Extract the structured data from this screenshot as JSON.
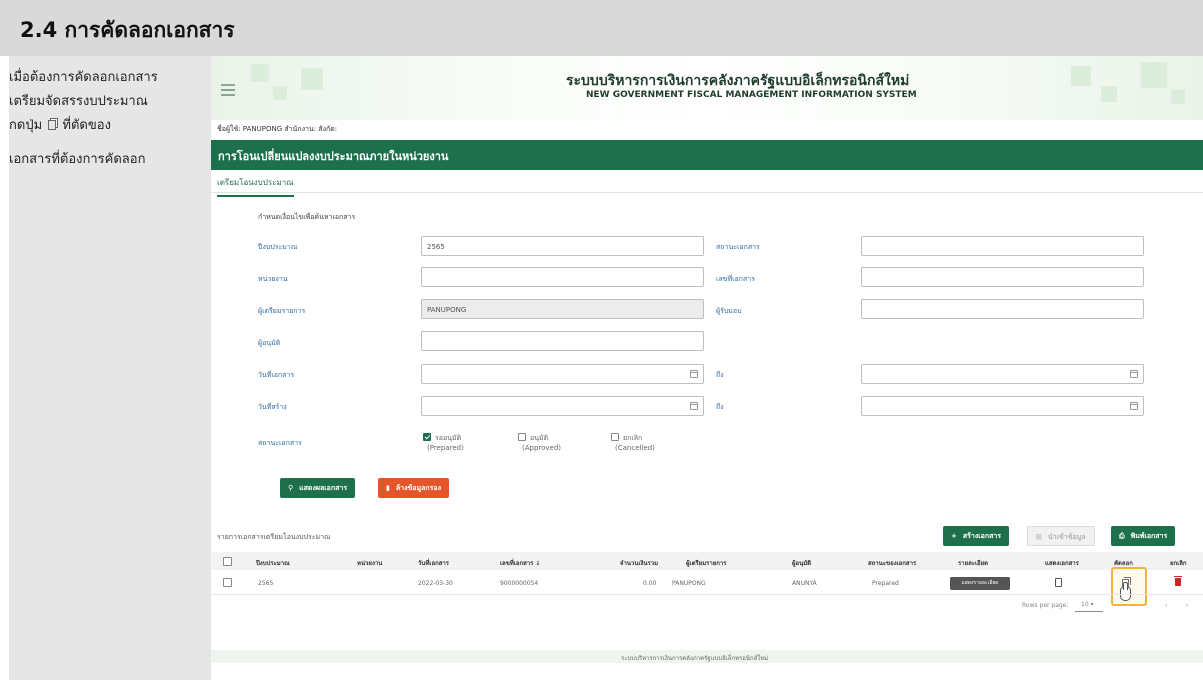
{
  "page": {
    "heading": "2.4 การคัดลอกเอกสาร"
  },
  "instructions": {
    "line1": "เมื่อต้องการคัดลอกเอกสาร",
    "line2": "เตรียมจัดสรรงบประมาณ",
    "line3_pre": "กดปุ่ม",
    "line3_post": "ที่ตัดของ",
    "line4": "เอกสารที่ต้องการคัดลอก"
  },
  "system": {
    "title_th": "ระบบบริหารการเงินการคลังภาครัฐแบบอิเล็กทรอนิกส์ใหม่",
    "title_en": "NEW GOVERNMENT FISCAL MANAGEMENT INFORMATION SYSTEM",
    "user_line": "ชื่อผู้ใช้: PANUPONG   สำนักงาน:   สังกัด:"
  },
  "app": {
    "section_title": "การโอนเปลี่ยนแปลงงบประมาณภายในหน่วยงาน",
    "tab_label": "เตรียมโอนงบประมาณ"
  },
  "form": {
    "hint": "กำหนดเงื่อนไขเพื่อค้นหาเอกสาร",
    "fiscal_year_label": "ปีงบประมาณ",
    "fiscal_year_value": "2565",
    "doc_status_label": "สถานะเอกสาร",
    "unit_label": "หน่วยงาน",
    "doc_no_label": "เลขที่เอกสาร",
    "preparer_label": "ผู้เตรียมรายการ",
    "preparer_value": "PANUPONG",
    "reviewer_label": "ผู้รับมอบ",
    "approver_label": "ผู้อนุมัติ",
    "doc_date_label": "วันที่เอกสาร",
    "to_label": "ถึง",
    "created_date_label": "วันที่สร้าง",
    "status_label": "สถานะเอกสาร",
    "status_prepared": "รออนุมัติ",
    "status_prepared_en": "(Prepared)",
    "status_approved": "อนุมัติ",
    "status_approved_en": "(Approved)",
    "status_cancelled": "ยกเลิก",
    "status_cancelled_en": "(Cancelled)",
    "search_button": "แสดงผลเอกสาร",
    "clear_button": "ล้างข้อมูลกรอง"
  },
  "list": {
    "title": "รายการเอกสารเตรียมโอนงบประมาณ",
    "create_button": "สร้างเอกสาร",
    "import_button": "นำเข้าข้อมูล",
    "print_button": "พิมพ์เอกสาร",
    "columns": {
      "fiscal_year": "ปีงบประมาณ",
      "unit": "หน่วยงาน",
      "doc_date": "วันที่เอกสาร",
      "doc_no": "เลขที่เอกสาร ↓",
      "amount": "จำนวนเงินรวม",
      "preparer": "ผู้เตรียมรายการ",
      "approver": "ผู้อนุมัติ",
      "status": "สถานะของเอกสาร",
      "details": "รายละเอียด",
      "show_doc": "แสดงเอกสาร",
      "copy": "คัดลอก",
      "cancel": "ยกเลิก"
    },
    "rows": [
      {
        "fiscal_year": "2565",
        "doc_date": "2022-03-30",
        "doc_no": "9000000054",
        "amount": "0.00",
        "preparer": "PANUPONG",
        "approver": "ANUNYA",
        "status": "Prepared",
        "details_button": "แสดงรายละเอียด"
      }
    ],
    "rows_per_page_label": "Rows per page:",
    "rows_per_page_value": "10"
  },
  "footer": {
    "text": "ระบบบริหารการเงินการคลังภาครัฐแบบอิเล็กทรอนิกส์ใหม่"
  },
  "colors": {
    "primary_green": "#1e6f4c",
    "danger_orange": "#e4562a",
    "highlight": "#f0b43c"
  }
}
